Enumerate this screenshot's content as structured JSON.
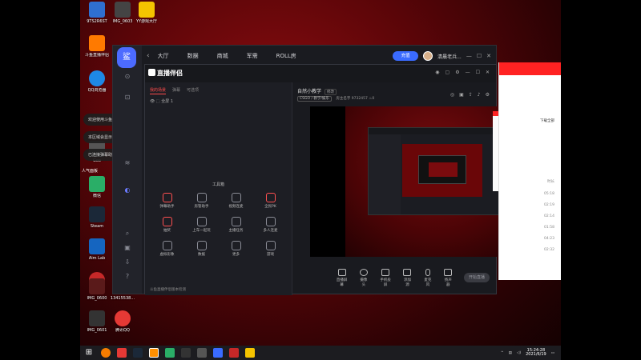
{
  "desktop": {
    "icons": [
      {
        "label": "9TS2R6ST",
        "color": "#2f6fd0"
      },
      {
        "label": "IMG_0603",
        "color": "#444"
      },
      {
        "label": "YY游戏大厅",
        "color": "#f5c400"
      },
      {
        "label": "斗鱼直播伴侣",
        "color": "#ff7a00"
      },
      {
        "label": "QQ浏览器",
        "color": "#1e88e5"
      },
      {
        "label": "微信",
        "color": "#2aae67"
      },
      {
        "label": "Steam",
        "color": "#1b2838"
      },
      {
        "label": "Aim Lab",
        "color": "#1565c0"
      },
      {
        "label": "IMG_0600",
        "color": "#5a1a1a"
      },
      {
        "label": "IMG_0601",
        "color": "#333"
      },
      {
        "label": "腾讯QQ",
        "color": "#e53935"
      },
      {
        "label": "Goo",
        "color": "#888"
      },
      {
        "label": "SE",
        "color": "#777"
      },
      {
        "label": "13415538...",
        "color": "#444"
      }
    ],
    "toasts": [
      "欢迎使用斗鱼弹幕助手",
      "本区域会显示弹幕消息和礼物消息",
      "已连接弹幕助手成功"
    ],
    "section_label": "人气面板"
  },
  "app": {
    "nav": [
      "大厅",
      "数据",
      "商城",
      "军需",
      "ROLL房"
    ],
    "coin_label": "充值",
    "username": "清晨老兵...",
    "window_controls": [
      "—",
      "☐",
      "✕"
    ]
  },
  "tool": {
    "brand": "直播伴侣",
    "tabs": [
      "我的场景",
      "弹幕",
      "可选项"
    ],
    "scene_label": "全屏 1",
    "toolbox_title": "工具箱",
    "tools": [
      {
        "label": "弹幕助手",
        "accent": true
      },
      {
        "label": "房管助手",
        "accent": false
      },
      {
        "label": "视频连麦",
        "accent": false
      },
      {
        "label": "全民PK",
        "accent": true
      },
      {
        "label": "抽奖",
        "accent": true
      },
      {
        "label": "上车一起玩",
        "accent": false
      },
      {
        "label": "主播任务",
        "accent": false
      },
      {
        "label": "多人连麦",
        "accent": false
      },
      {
        "label": "虚拟形象",
        "accent": false
      },
      {
        "label": "数据",
        "accent": false
      },
      {
        "label": "更多",
        "accent": false
      },
      {
        "label": "游戏",
        "accent": false
      }
    ],
    "footer": "斗鱼直播伴侣版本检测",
    "room_title": "自然小教学",
    "room_tag": "修改",
    "room_category": "CSGO / 教学/娱乐",
    "room_owner": "房主名字",
    "room_id": "9732457",
    "heat": "0",
    "controls": [
      "直播屏幕",
      "摄像头",
      "手机投屏",
      "添加源",
      "麦克风",
      "扬声器"
    ],
    "start_button": "开始直播"
  },
  "right_window": {
    "text_link": "下载全部",
    "rows": [
      "时长",
      "05:18",
      "02:19",
      "02:14",
      "01:58",
      "04:23",
      "02:32"
    ]
  },
  "taskbar": {
    "time": "15:24:28",
    "date": "2021/6/19"
  }
}
